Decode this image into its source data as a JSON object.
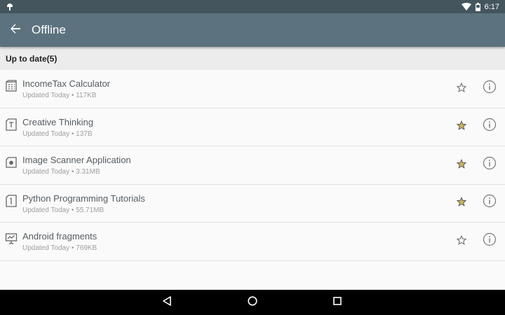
{
  "status_bar": {
    "time": "6:17",
    "icons": [
      "android-notification-icon",
      "wifi-icon",
      "battery-icon"
    ]
  },
  "app_bar": {
    "title": "Offline",
    "back_icon": "arrow-back-icon",
    "color": "#5c737f"
  },
  "section": {
    "header": "Up to date(5)"
  },
  "items": [
    {
      "title": "IncomeTax Calculator",
      "subtitle": "Updated Today • 117KB",
      "icon": "calculator-icon",
      "starred": false
    },
    {
      "title": "Creative Thinking",
      "subtitle": "Updated Today • 137B",
      "icon": "text-document-icon",
      "starred": true
    },
    {
      "title": "Image Scanner Application",
      "subtitle": "Updated Today • 3.31MB",
      "icon": "scanner-icon",
      "starred": true
    },
    {
      "title": "Python Programming Tutorials",
      "subtitle": "Updated Today • 55.71MB",
      "icon": "book-icon",
      "starred": true
    },
    {
      "title": "Android fragments",
      "subtitle": "Updated Today • 769KB",
      "icon": "presentation-icon",
      "starred": false
    }
  ],
  "colors": {
    "star_filled": "#c9b458",
    "star_empty": "#777777",
    "info": "#777777"
  },
  "nav_bar": {
    "icons": [
      "back-triangle-icon",
      "home-circle-icon",
      "recents-square-icon"
    ]
  }
}
